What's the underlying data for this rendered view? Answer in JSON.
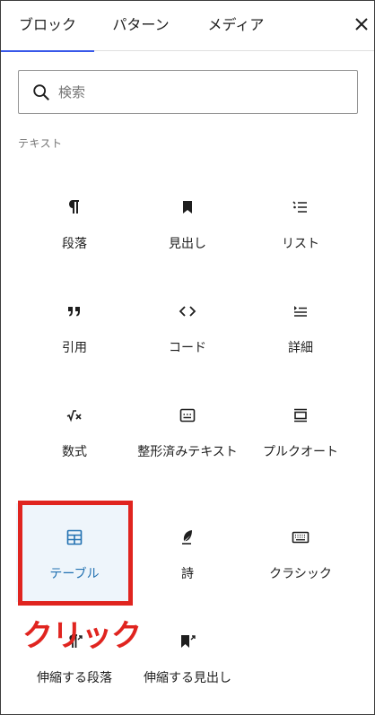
{
  "tabs": [
    {
      "label": "ブロック"
    },
    {
      "label": "パターン"
    },
    {
      "label": "メディア"
    }
  ],
  "search": {
    "placeholder": "検索",
    "value": ""
  },
  "category": {
    "label": "テキスト"
  },
  "blocks": [
    {
      "label": "段落",
      "icon": "paragraph-icon"
    },
    {
      "label": "見出し",
      "icon": "heading-bookmark-icon"
    },
    {
      "label": "リスト",
      "icon": "list-icon"
    },
    {
      "label": "引用",
      "icon": "quote-icon"
    },
    {
      "label": "コード",
      "icon": "code-icon"
    },
    {
      "label": "詳細",
      "icon": "details-icon"
    },
    {
      "label": "数式",
      "icon": "math-icon"
    },
    {
      "label": "整形済みテキスト",
      "icon": "preformatted-icon"
    },
    {
      "label": "プルクオート",
      "icon": "pullquote-icon"
    },
    {
      "label": "テーブル",
      "icon": "table-icon",
      "selected": true
    },
    {
      "label": "詩",
      "icon": "verse-feather-icon"
    },
    {
      "label": "クラシック",
      "icon": "keyboard-icon"
    },
    {
      "label": "伸縮する段落",
      "icon": "fit-paragraph-icon"
    },
    {
      "label": "伸縮する見出し",
      "icon": "fit-heading-icon"
    }
  ],
  "annotation": {
    "text": "クリック"
  },
  "colors": {
    "accent": "#3858e9",
    "selected": "#2271b1",
    "highlight": "#e0241f"
  }
}
